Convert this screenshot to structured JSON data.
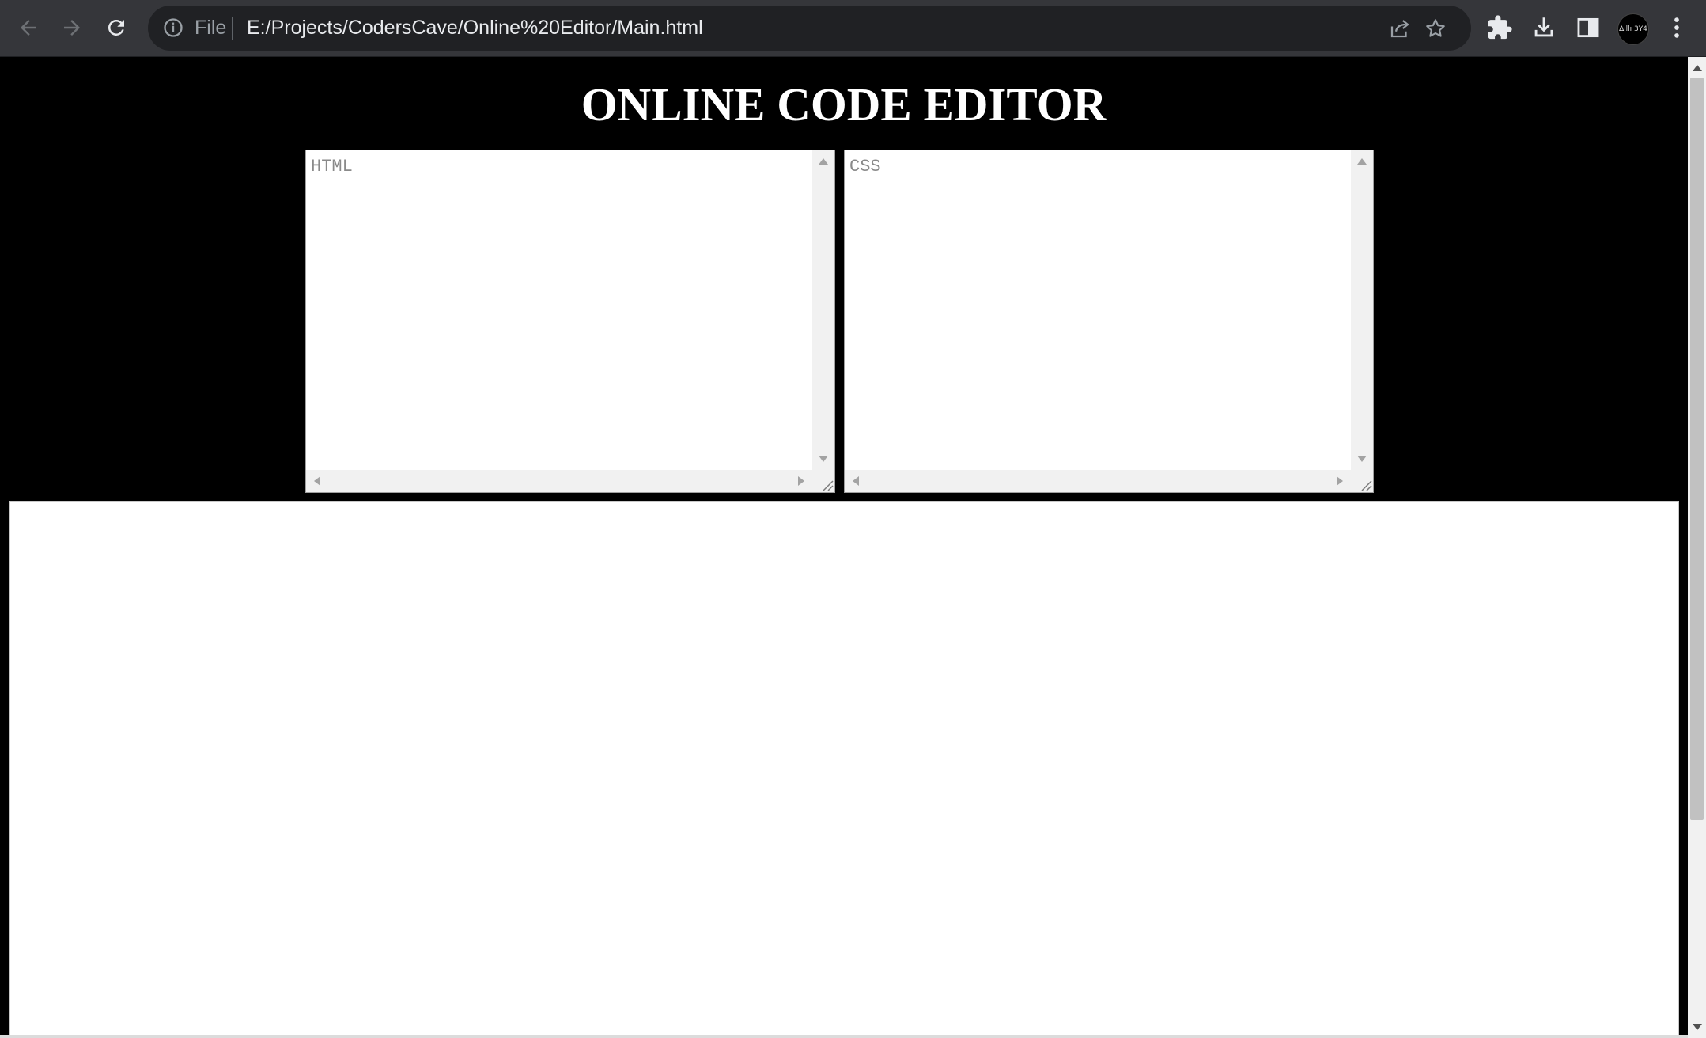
{
  "browser": {
    "omnibox": {
      "scheme_label": "File",
      "url": "E:/Projects/CodersCave/Online%20Editor/Main.html"
    },
    "icons": {
      "back": "arrow-left-icon",
      "forward": "arrow-right-icon",
      "reload": "reload-icon",
      "info": "info-icon",
      "share": "share-icon",
      "bookmark": "star-icon",
      "extensions": "puzzle-icon",
      "downloads": "download-icon",
      "side_panel": "side-panel-icon",
      "menu": "kebab-menu-icon"
    },
    "avatar_text": "∆ıllı 3Y4",
    "colors": {
      "toolbar": "#35363a",
      "omnibox": "#202124",
      "text": "#e8eaed"
    }
  },
  "page": {
    "title": "ONLINE CODE EDITOR",
    "editors": {
      "html_placeholder": "HTML",
      "css_placeholder": "CSS"
    },
    "colors": {
      "background": "#000000",
      "title": "#ffffff",
      "editor_bg": "#ffffff"
    }
  }
}
